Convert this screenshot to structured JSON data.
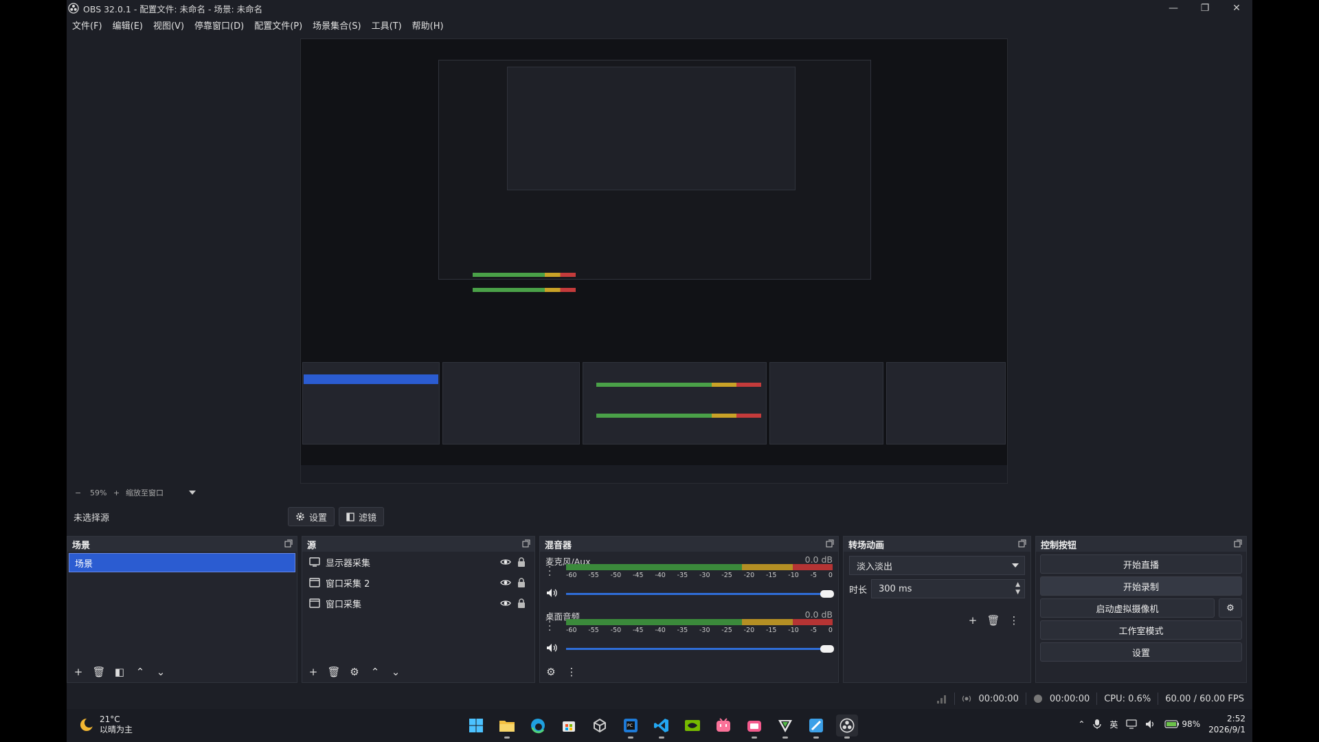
{
  "window": {
    "title": "OBS 32.0.1 - 配置文件: 未命名 - 场景: 未命名",
    "controls": [
      "—",
      "❐",
      "✕"
    ]
  },
  "menu": [
    "文件(F)",
    "编辑(E)",
    "视图(V)",
    "停靠窗口(D)",
    "配置文件(P)",
    "场景集合(S)",
    "工具(T)",
    "帮助(H)"
  ],
  "zoom": {
    "minus": "−",
    "value": "59%",
    "plus": "+",
    "mode": "缩放至窗口"
  },
  "source_toolbar": {
    "no_source": "未选择源",
    "settings": "设置",
    "filters": "滤镜"
  },
  "scenes": {
    "title": "场景",
    "items": [
      "场景"
    ]
  },
  "sources": {
    "title": "源",
    "items": [
      {
        "name": "显示器采集",
        "icon": "monitor-icon"
      },
      {
        "name": "窗口采集 2",
        "icon": "window-icon"
      },
      {
        "name": "窗口采集",
        "icon": "window-icon"
      }
    ]
  },
  "mixer": {
    "title": "混音器",
    "channels": [
      {
        "name": "麦克风/Aux",
        "db": "0.0 dB",
        "volume": 1.0
      },
      {
        "name": "桌面音频",
        "db": "0.0 dB",
        "volume": 1.0
      }
    ],
    "ticks": [
      "-60",
      "-55",
      "-50",
      "-45",
      "-40",
      "-35",
      "-30",
      "-25",
      "-20",
      "-15",
      "-10",
      "-5",
      "0"
    ]
  },
  "transitions": {
    "title": "转场动画",
    "selected": "淡入淡出",
    "duration_label": "时长",
    "duration": "300 ms"
  },
  "controls": {
    "title": "控制按钮",
    "start_stream": "开始直播",
    "start_record": "开始录制",
    "virtual_cam": "启动虚拟摄像机",
    "studio_mode": "工作室模式",
    "settings": "设置"
  },
  "status": {
    "stream_time": "00:00:00",
    "record_time": "00:00:00",
    "cpu": "CPU: 0.6%",
    "fps": "60.00 / 60.00 FPS"
  },
  "taskbar": {
    "weather_temp": "21°C",
    "weather_desc": "以晴为主",
    "apps": [
      "windows-start-icon",
      "file-explorer-icon",
      "edge-icon",
      "store-icon",
      "unity-icon",
      "pycharm-icon",
      "vscode-icon",
      "nvidia-icon",
      "bilibili-icon",
      "bilibili-live-icon",
      "vim-icon",
      "draw-icon",
      "obs-icon"
    ],
    "ime": "英",
    "battery": "98%",
    "time": "2:52",
    "date": "2026/9/1"
  },
  "colors": {
    "window_bg": "#1d1f26",
    "panel_bg": "#23252d",
    "selection": "#2b5cd1",
    "meter_green": "#3b8a3b",
    "meter_yellow": "#b48f24",
    "meter_red": "#b53434",
    "volume_track": "#2f6ed9"
  }
}
